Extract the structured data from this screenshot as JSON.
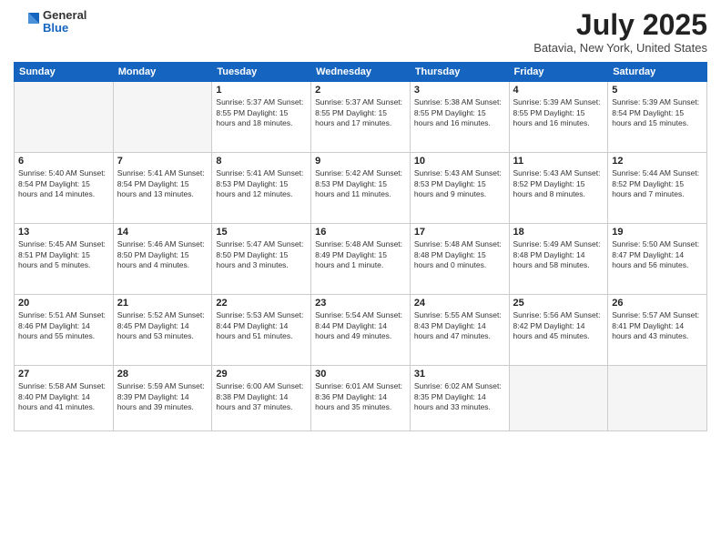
{
  "logo": {
    "general": "General",
    "blue": "Blue"
  },
  "title": "July 2025",
  "location": "Batavia, New York, United States",
  "weekdays": [
    "Sunday",
    "Monday",
    "Tuesday",
    "Wednesday",
    "Thursday",
    "Friday",
    "Saturday"
  ],
  "weeks": [
    [
      {
        "day": "",
        "detail": ""
      },
      {
        "day": "",
        "detail": ""
      },
      {
        "day": "1",
        "detail": "Sunrise: 5:37 AM\nSunset: 8:55 PM\nDaylight: 15 hours\nand 18 minutes."
      },
      {
        "day": "2",
        "detail": "Sunrise: 5:37 AM\nSunset: 8:55 PM\nDaylight: 15 hours\nand 17 minutes."
      },
      {
        "day": "3",
        "detail": "Sunrise: 5:38 AM\nSunset: 8:55 PM\nDaylight: 15 hours\nand 16 minutes."
      },
      {
        "day": "4",
        "detail": "Sunrise: 5:39 AM\nSunset: 8:55 PM\nDaylight: 15 hours\nand 16 minutes."
      },
      {
        "day": "5",
        "detail": "Sunrise: 5:39 AM\nSunset: 8:54 PM\nDaylight: 15 hours\nand 15 minutes."
      }
    ],
    [
      {
        "day": "6",
        "detail": "Sunrise: 5:40 AM\nSunset: 8:54 PM\nDaylight: 15 hours\nand 14 minutes."
      },
      {
        "day": "7",
        "detail": "Sunrise: 5:41 AM\nSunset: 8:54 PM\nDaylight: 15 hours\nand 13 minutes."
      },
      {
        "day": "8",
        "detail": "Sunrise: 5:41 AM\nSunset: 8:53 PM\nDaylight: 15 hours\nand 12 minutes."
      },
      {
        "day": "9",
        "detail": "Sunrise: 5:42 AM\nSunset: 8:53 PM\nDaylight: 15 hours\nand 11 minutes."
      },
      {
        "day": "10",
        "detail": "Sunrise: 5:43 AM\nSunset: 8:53 PM\nDaylight: 15 hours\nand 9 minutes."
      },
      {
        "day": "11",
        "detail": "Sunrise: 5:43 AM\nSunset: 8:52 PM\nDaylight: 15 hours\nand 8 minutes."
      },
      {
        "day": "12",
        "detail": "Sunrise: 5:44 AM\nSunset: 8:52 PM\nDaylight: 15 hours\nand 7 minutes."
      }
    ],
    [
      {
        "day": "13",
        "detail": "Sunrise: 5:45 AM\nSunset: 8:51 PM\nDaylight: 15 hours\nand 5 minutes."
      },
      {
        "day": "14",
        "detail": "Sunrise: 5:46 AM\nSunset: 8:50 PM\nDaylight: 15 hours\nand 4 minutes."
      },
      {
        "day": "15",
        "detail": "Sunrise: 5:47 AM\nSunset: 8:50 PM\nDaylight: 15 hours\nand 3 minutes."
      },
      {
        "day": "16",
        "detail": "Sunrise: 5:48 AM\nSunset: 8:49 PM\nDaylight: 15 hours\nand 1 minute."
      },
      {
        "day": "17",
        "detail": "Sunrise: 5:48 AM\nSunset: 8:48 PM\nDaylight: 15 hours\nand 0 minutes."
      },
      {
        "day": "18",
        "detail": "Sunrise: 5:49 AM\nSunset: 8:48 PM\nDaylight: 14 hours\nand 58 minutes."
      },
      {
        "day": "19",
        "detail": "Sunrise: 5:50 AM\nSunset: 8:47 PM\nDaylight: 14 hours\nand 56 minutes."
      }
    ],
    [
      {
        "day": "20",
        "detail": "Sunrise: 5:51 AM\nSunset: 8:46 PM\nDaylight: 14 hours\nand 55 minutes."
      },
      {
        "day": "21",
        "detail": "Sunrise: 5:52 AM\nSunset: 8:45 PM\nDaylight: 14 hours\nand 53 minutes."
      },
      {
        "day": "22",
        "detail": "Sunrise: 5:53 AM\nSunset: 8:44 PM\nDaylight: 14 hours\nand 51 minutes."
      },
      {
        "day": "23",
        "detail": "Sunrise: 5:54 AM\nSunset: 8:44 PM\nDaylight: 14 hours\nand 49 minutes."
      },
      {
        "day": "24",
        "detail": "Sunrise: 5:55 AM\nSunset: 8:43 PM\nDaylight: 14 hours\nand 47 minutes."
      },
      {
        "day": "25",
        "detail": "Sunrise: 5:56 AM\nSunset: 8:42 PM\nDaylight: 14 hours\nand 45 minutes."
      },
      {
        "day": "26",
        "detail": "Sunrise: 5:57 AM\nSunset: 8:41 PM\nDaylight: 14 hours\nand 43 minutes."
      }
    ],
    [
      {
        "day": "27",
        "detail": "Sunrise: 5:58 AM\nSunset: 8:40 PM\nDaylight: 14 hours\nand 41 minutes."
      },
      {
        "day": "28",
        "detail": "Sunrise: 5:59 AM\nSunset: 8:39 PM\nDaylight: 14 hours\nand 39 minutes."
      },
      {
        "day": "29",
        "detail": "Sunrise: 6:00 AM\nSunset: 8:38 PM\nDaylight: 14 hours\nand 37 minutes."
      },
      {
        "day": "30",
        "detail": "Sunrise: 6:01 AM\nSunset: 8:36 PM\nDaylight: 14 hours\nand 35 minutes."
      },
      {
        "day": "31",
        "detail": "Sunrise: 6:02 AM\nSunset: 8:35 PM\nDaylight: 14 hours\nand 33 minutes."
      },
      {
        "day": "",
        "detail": ""
      },
      {
        "day": "",
        "detail": ""
      }
    ]
  ]
}
